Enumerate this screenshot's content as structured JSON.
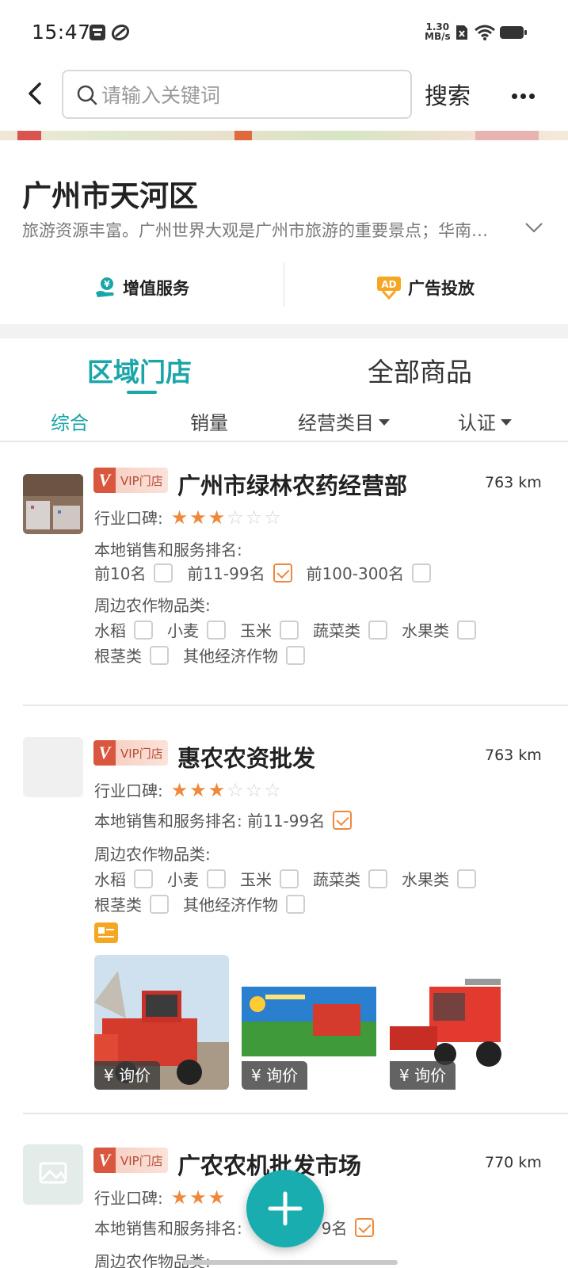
{
  "status_bar": {
    "time": "15:47",
    "net_speed_value": "1.30",
    "net_speed_unit": "MB/s",
    "icons": [
      "notification-icon",
      "app-icon",
      "sim-off-icon",
      "wifi-icon",
      "battery-icon"
    ]
  },
  "header": {
    "search_placeholder": "请输入关键词",
    "search_button": "搜索"
  },
  "region": {
    "title": "广州市天河区",
    "description": "旅游资源丰富。广州世界大观是广州市旅游的重要景点；华南…",
    "actions": [
      {
        "label": "增值服务",
        "icon": "money-hand-icon"
      },
      {
        "label": "广告投放",
        "icon": "ad-icon"
      }
    ]
  },
  "main_tabs": [
    {
      "label": "区域门店",
      "active": true
    },
    {
      "label": "全部商品",
      "active": false
    }
  ],
  "filters": [
    {
      "label": "综合",
      "active": true
    },
    {
      "label": "销量",
      "active": false
    },
    {
      "label": "经营类目",
      "active": false
    },
    {
      "label": "认证",
      "active": false
    }
  ],
  "labels": {
    "vip": "VIP门店",
    "reputation": "行业口碑:",
    "ranking": "本地销售和服务排名:",
    "crops": "周边农作物品类:",
    "ask_price": "¥ 询价"
  },
  "stores": [
    {
      "name": "广州市绿林农药经营部",
      "distance": "763 km",
      "rating": 3,
      "rank_options": [
        {
          "label": "前10名",
          "checked": false
        },
        {
          "label": "前11-99名",
          "checked": true
        },
        {
          "label": "前100-300名",
          "checked": false
        }
      ],
      "crops": [
        "水稻",
        "小麦",
        "玉米",
        "蔬菜类",
        "水果类",
        "根茎类",
        "其他经济作物"
      ]
    },
    {
      "name": "惠农农资批发",
      "distance": "763 km",
      "rating": 3,
      "rank_options": [
        {
          "label": "前11-99名",
          "checked": true
        }
      ],
      "crops": [
        "水稻",
        "小麦",
        "玉米",
        "蔬菜类",
        "水果类",
        "根茎类",
        "其他经济作物"
      ],
      "product_count": 3
    },
    {
      "name": "广农农机批发市场",
      "distance": "770 km",
      "rating": 3,
      "rank_partial": "9名"
    }
  ],
  "colors": {
    "accent": "#1aa5a8",
    "star": "#f0883b",
    "vip": "#d9573f"
  }
}
